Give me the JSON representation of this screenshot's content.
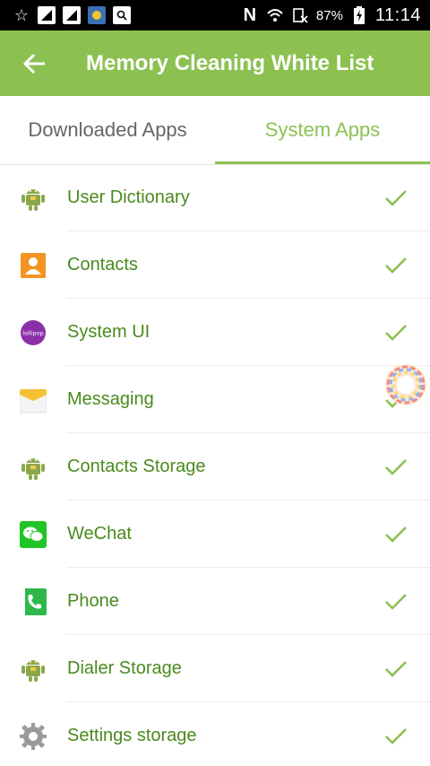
{
  "status_bar": {
    "battery_percent": "87%",
    "time": "11:14"
  },
  "app_bar": {
    "title": "Memory Cleaning White List"
  },
  "tabs": [
    {
      "label": "Downloaded Apps",
      "active": false
    },
    {
      "label": "System Apps",
      "active": true
    }
  ],
  "apps": [
    {
      "name": "User Dictionary",
      "icon": "android-icon",
      "checked": true
    },
    {
      "name": "Contacts",
      "icon": "contacts-icon",
      "checked": true
    },
    {
      "name": "System UI",
      "icon": "lollipop-icon",
      "checked": true
    },
    {
      "name": "Messaging",
      "icon": "messaging-icon",
      "checked": true
    },
    {
      "name": "Contacts Storage",
      "icon": "android-icon",
      "checked": true
    },
    {
      "name": "WeChat",
      "icon": "wechat-icon",
      "checked": true
    },
    {
      "name": "Phone",
      "icon": "phone-icon",
      "checked": true
    },
    {
      "name": "Dialer Storage",
      "icon": "android-icon",
      "checked": true
    },
    {
      "name": "Settings storage",
      "icon": "settings-icon",
      "checked": true
    }
  ],
  "colors": {
    "accent": "#8cc152",
    "app_name": "#4a8a1e",
    "status_bar": "#000000"
  }
}
